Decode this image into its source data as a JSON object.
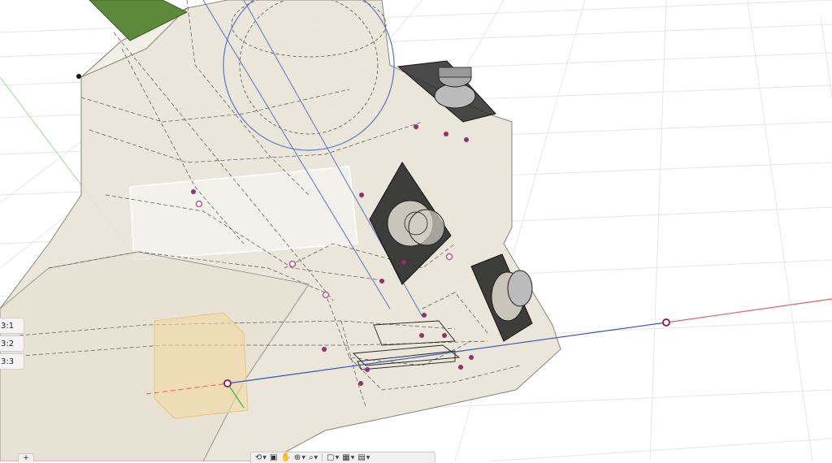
{
  "sketch_profiles": [
    "3:1",
    "3:2",
    "3:3"
  ],
  "toolbar": {
    "items": [
      {
        "name": "orbit",
        "glyph": "⟲"
      },
      {
        "name": "look-at",
        "glyph": "▣"
      },
      {
        "name": "pan",
        "glyph": "✋"
      },
      {
        "name": "zoom",
        "glyph": "⊕"
      },
      {
        "name": "fit",
        "glyph": "⌕"
      },
      {
        "name": "display-settings",
        "glyph": "▢"
      },
      {
        "name": "grid-settings",
        "glyph": "▦"
      },
      {
        "name": "viewports",
        "glyph": "▤"
      }
    ]
  },
  "bottom_left_control": "+",
  "colors": {
    "background": "#ffffff",
    "grid": "#e6e6e6",
    "body_fill": "#e9e3d6",
    "body_edge": "#7f7a70",
    "axis_blue": "#3355cc",
    "axis_red": "#e05050",
    "axis_green": "#40b040",
    "origin_box": "#f3d9a4",
    "fan_dark": "#2a2a2a",
    "cylinder_green": "#5d8a3a",
    "point_marker": "#9a2e6a"
  }
}
